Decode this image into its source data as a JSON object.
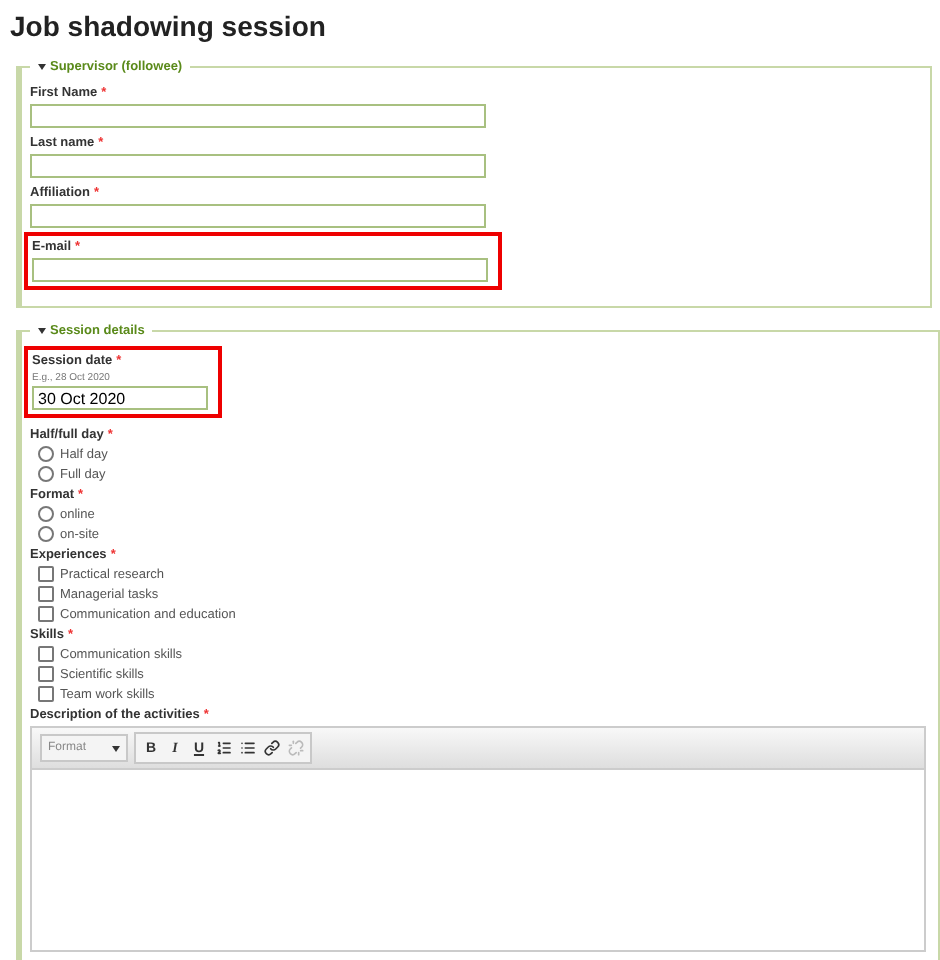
{
  "title": "Job shadowing session",
  "supervisor": {
    "legend": "Supervisor (followee)",
    "expanded": true,
    "fields": [
      {
        "label": "First Name",
        "required": "*",
        "highlighted": false
      },
      {
        "label": "Last name",
        "required": "*",
        "highlighted": false
      },
      {
        "label": "Affiliation",
        "required": "*",
        "highlighted": false
      },
      {
        "label": "E-mail",
        "required": "*",
        "highlighted": true
      }
    ]
  },
  "session": {
    "legend": "Session details",
    "expanded": true,
    "date": {
      "label": "Session date",
      "required": "*",
      "hint": "E.g., 28 Oct 2020",
      "value": "30 Oct 2020",
      "highlighted": true
    },
    "groups": [
      {
        "label": "Half/full day",
        "required": "*",
        "kind": "radio",
        "options": [
          {
            "label": "Half day",
            "checked": false
          },
          {
            "label": "Full day",
            "checked": false
          }
        ]
      },
      {
        "label": "Format",
        "required": "*",
        "kind": "radio",
        "options": [
          {
            "label": "online",
            "checked": false
          },
          {
            "label": "on-site",
            "checked": false
          }
        ]
      },
      {
        "label": "Experiences",
        "required": "*",
        "kind": "checkbox",
        "options": [
          {
            "label": "Practical research",
            "checked": false
          },
          {
            "label": "Managerial tasks",
            "checked": false
          },
          {
            "label": "Communication and education",
            "checked": false
          }
        ]
      },
      {
        "label": "Skills",
        "required": "*",
        "kind": "checkbox",
        "options": [
          {
            "label": "Communication skills",
            "checked": false
          },
          {
            "label": "Scientific skills",
            "checked": false
          },
          {
            "label": "Team work skills",
            "checked": false
          }
        ]
      }
    ],
    "description": {
      "label": "Description of the activities",
      "required": "*",
      "format": "Format",
      "tools": [
        {
          "kind": "bold",
          "label": "B",
          "disabled": false
        },
        {
          "kind": "italic",
          "label": "I",
          "disabled": false
        },
        {
          "kind": "underline",
          "label": "U",
          "disabled": false
        },
        {
          "kind": "ordered-list",
          "disabled": false
        },
        {
          "kind": "bullet-list",
          "disabled": false
        },
        {
          "kind": "link",
          "disabled": false
        },
        {
          "kind": "unlink",
          "disabled": true
        }
      ]
    }
  }
}
